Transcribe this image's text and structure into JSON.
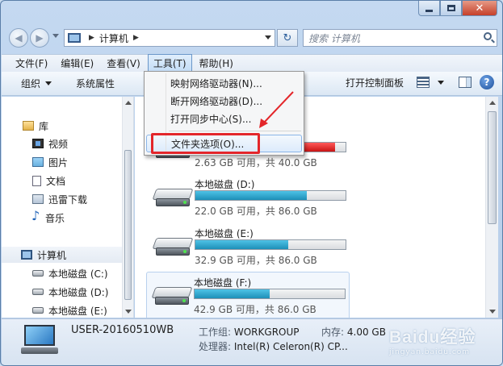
{
  "window": {
    "caption": {
      "minimize_icon": "minimize-icon",
      "maximize_icon": "maximize-icon",
      "close_glyph": "✕"
    }
  },
  "nav": {
    "back_glyph": "◀",
    "forward_glyph": "▶",
    "breadcrumb": [
      "计算机"
    ],
    "refresh_glyph": "↻",
    "search_placeholder": "搜索 计算机"
  },
  "menubar": {
    "items": [
      "文件(F)",
      "编辑(E)",
      "查看(V)",
      "工具(T)",
      "帮助(H)"
    ],
    "active_index": 3
  },
  "toolbar": {
    "organize": "组织",
    "system_properties": "系统属性",
    "open_control_panel": "打开控制面板",
    "help_glyph": "?"
  },
  "tools_menu": {
    "items": [
      "映射网络驱动器(N)...",
      "断开网络驱动器(D)...",
      "打开同步中心(S)..."
    ],
    "highlighted": "文件夹选项(O)..."
  },
  "navpane": {
    "library": "库",
    "library_items": [
      "视频",
      "图片",
      "文档",
      "迅雷下载",
      "音乐"
    ],
    "computer": "计算机",
    "drives": [
      "本地磁盘 (C:)",
      "本地磁盘 (D:)",
      "本地磁盘 (E:)"
    ]
  },
  "drives": [
    {
      "name": "",
      "info": "2.63 GB 可用，共 40.0 GB",
      "used_fraction": 0.93,
      "critical": true
    },
    {
      "name": "本地磁盘 (D:)",
      "info": "22.0 GB 可用，共 86.0 GB",
      "used_fraction": 0.74,
      "critical": false
    },
    {
      "name": "本地磁盘 (E:)",
      "info": "32.9 GB 可用，共 86.0 GB",
      "used_fraction": 0.62,
      "critical": false
    },
    {
      "name": "本地磁盘 (F:)",
      "info": "42.9 GB 可用，共 86.0 GB",
      "used_fraction": 0.5,
      "critical": false
    }
  ],
  "details": {
    "computer_name": "USER-20160510WB",
    "workgroup_label": "工作组:",
    "workgroup": "WORKGROUP",
    "memory_label": "内存:",
    "memory": "4.00 GB",
    "cpu_label": "处理器:",
    "cpu": "Intel(R) Celeron(R) CP..."
  },
  "watermark": {
    "logo": "Baidu经验",
    "sub": "jingyan.baidu.com"
  },
  "colors": {
    "annotation": "#e3262a",
    "disk_bar": "#1d8fb8",
    "disk_bar_critical": "#c91414"
  }
}
